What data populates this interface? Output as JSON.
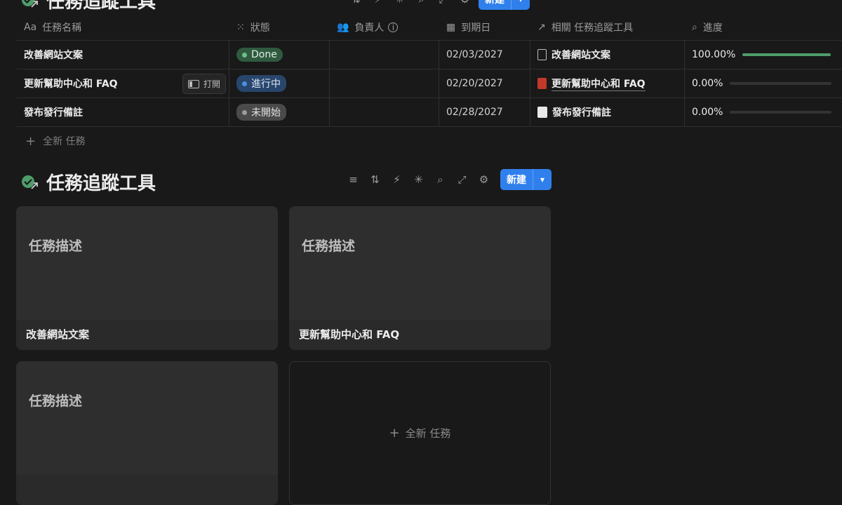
{
  "top_db": {
    "title": "任務追蹤工具",
    "new_button": "新建",
    "columns": [
      {
        "label": "任務名稱",
        "icon": "Aa"
      },
      {
        "label": "狀態",
        "icon": "status-icon"
      },
      {
        "label": "負責人",
        "icon": "people-icon"
      },
      {
        "label": "到期日",
        "icon": "calendar-icon"
      },
      {
        "label": "相關 任務追蹤工具",
        "icon": "arrow-up-right-icon"
      },
      {
        "label": "進度",
        "icon": "search-icon"
      }
    ],
    "rows": [
      {
        "name": "改善網站文案",
        "status": "Done",
        "status_color": "#4f9c6b",
        "status_bg": "#2f5a3f",
        "due": "02/03/2027",
        "related": "改善網站文案",
        "related_icon": "doc-icon",
        "progress_text": "100.00%",
        "progress": 1.0
      },
      {
        "name": "更新幫助中心和 FAQ",
        "open_label": "打開",
        "status": "進行中",
        "status_color": "#4a90e2",
        "status_bg": "#28456b",
        "due": "02/20/2027",
        "related": "更新幫助中心和 FAQ",
        "related_icon": "book-icon",
        "progress_text": "0.00%",
        "progress": 0.0
      },
      {
        "name": "發布發行備註",
        "status": "未開始",
        "status_color": "#9b9b9b",
        "status_bg": "#4a4a4a",
        "due": "02/28/2027",
        "related": "發布發行備註",
        "related_icon": "notepad-icon",
        "progress_text": "0.00%",
        "progress": 0.0
      }
    ],
    "add_row": "全新 任務"
  },
  "gallery_db": {
    "title": "任務追蹤工具",
    "new_button": "新建",
    "cards": [
      {
        "desc": "任務描述",
        "title": "改善網站文案"
      },
      {
        "desc": "任務描述",
        "title": "更新幫助中心和 FAQ"
      },
      {
        "desc": "任務描述",
        "title": ""
      }
    ],
    "add_card": "全新 任務"
  },
  "colors": {
    "accent": "#2f80ed",
    "background": "#191919"
  }
}
